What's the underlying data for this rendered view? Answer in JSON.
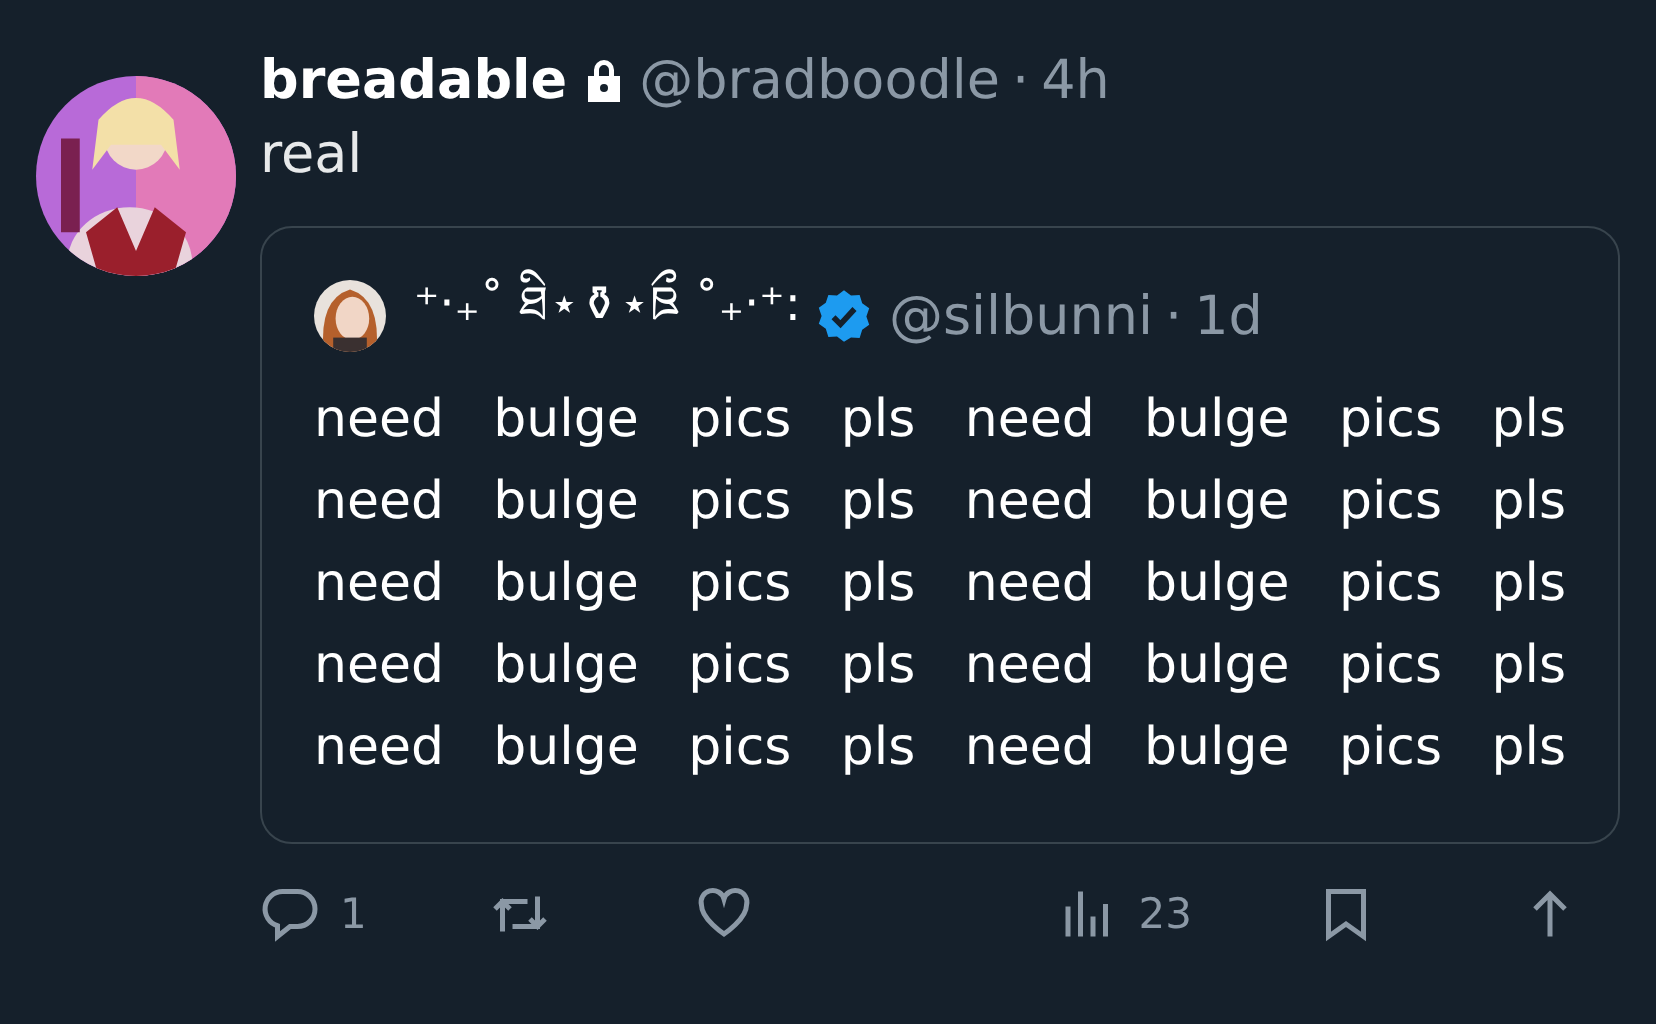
{
  "tweet": {
    "display_name": "breadable",
    "protected": true,
    "handle": "@bradboodle",
    "separator": "·",
    "time": "4h",
    "text": "real"
  },
  "quote": {
    "display_name": "⁺‧₊˚ ཐི⋆⚱⋆ཋྀ ˚₊‧⁺:",
    "verified": true,
    "handle": "@silbunni",
    "separator": "·",
    "time": "1d",
    "lines": [
      "need bulge pics pls need bulge pics pls",
      "need bulge pics pls need bulge pics pls",
      "need bulge pics pls need bulge pics pls",
      "need bulge pics pls need bulge pics pls",
      "need bulge pics pls need bulge pics pls"
    ]
  },
  "actions": [
    {
      "kind": "reply",
      "count": "1"
    },
    {
      "kind": "retweet"
    },
    {
      "kind": "like"
    },
    {
      "kind": "views",
      "count": "23"
    },
    {
      "kind": "bookmark"
    },
    {
      "kind": "share"
    }
  ]
}
